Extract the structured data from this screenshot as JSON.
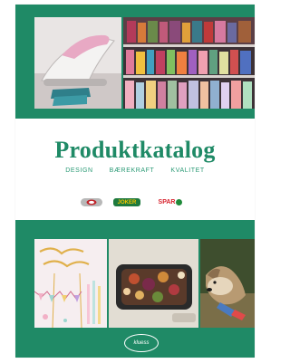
{
  "catalog": {
    "title": "Produktkatalog",
    "tagline": [
      "DESIGN",
      "BÆREKRAFT",
      "KVALITET"
    ]
  },
  "brands": [
    {
      "name": "brand-1-logo",
      "label": ""
    },
    {
      "name": "jokerl-logo",
      "label": "JOKER"
    },
    {
      "name": "spar-logo",
      "label": "SPAR"
    }
  ],
  "photos": [
    {
      "name": "iron-photo",
      "subject": "ironing"
    },
    {
      "name": "shelf-photo",
      "subject": "shelves with goods"
    },
    {
      "name": "party-photo",
      "subject": "happy birthday decoration"
    },
    {
      "name": "food-photo",
      "subject": "baking dish with food"
    },
    {
      "name": "dog-photo",
      "subject": "dog with toy"
    }
  ],
  "footer": {
    "logo_label": "kluess"
  },
  "colors": {
    "brand_green": "#1f8a66",
    "tagline_green": "#2a9a75",
    "white": "#ffffff"
  }
}
